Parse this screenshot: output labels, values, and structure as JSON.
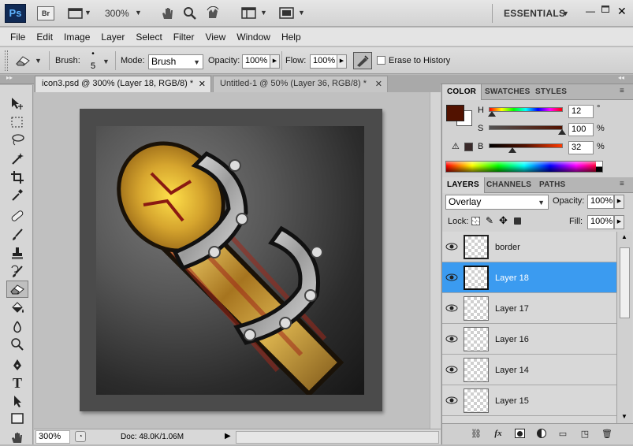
{
  "app": {
    "logo": "Ps",
    "bridge_label": "Br",
    "zoom": "300%",
    "workspace": "ESSENTIALS"
  },
  "menu": [
    "File",
    "Edit",
    "Image",
    "Layer",
    "Select",
    "Filter",
    "View",
    "Window",
    "Help"
  ],
  "options": {
    "brush_label": "Brush:",
    "brush_size": "5",
    "mode_label": "Mode:",
    "mode_value": "Brush",
    "opacity_label": "Opacity:",
    "opacity_value": "100%",
    "flow_label": "Flow:",
    "flow_value": "100%",
    "erase_history_label": "Erase to History"
  },
  "tabs": [
    {
      "label": "icon3.psd @ 300% (Layer 18, RGB/8) *",
      "active": true
    },
    {
      "label": "Untitled-1 @ 50% (Layer 36, RGB/8) *",
      "active": false
    }
  ],
  "status": {
    "zoom": "300%",
    "doc": "Doc: 48.0K/1.06M"
  },
  "color_panel": {
    "tabs": [
      "COLOR",
      "SWATCHES",
      "STYLES"
    ],
    "h_label": "H",
    "h_value": "12",
    "h_unit": "°",
    "s_label": "S",
    "s_value": "100",
    "s_unit": "%",
    "b_label": "B",
    "b_value": "32",
    "b_unit": "%",
    "foreground": "#521200",
    "background": "#ffffff"
  },
  "layers_panel": {
    "tabs": [
      "LAYERS",
      "CHANNELS",
      "PATHS"
    ],
    "blend_mode": "Overlay",
    "opacity_label": "Opacity:",
    "opacity_value": "100%",
    "lock_label": "Lock:",
    "fill_label": "Fill:",
    "fill_value": "100%",
    "layers": [
      {
        "name": "border",
        "selected": false
      },
      {
        "name": "Layer 18",
        "selected": true
      },
      {
        "name": "Layer 17",
        "selected": false
      },
      {
        "name": "Layer 16",
        "selected": false
      },
      {
        "name": "Layer 14",
        "selected": false
      },
      {
        "name": "Layer 15",
        "selected": false
      }
    ]
  },
  "tools": [
    "move-tool",
    "marquee-tool",
    "lasso-tool",
    "magic-wand-tool",
    "crop-tool",
    "eyedropper-tool",
    "healing-brush-tool",
    "brush-tool",
    "clone-stamp-tool",
    "history-brush-tool",
    "eraser-tool",
    "paint-bucket-tool",
    "blur-tool",
    "dodge-tool",
    "pen-tool",
    "type-tool",
    "path-selection-tool",
    "rectangle-tool",
    "hand-tool"
  ],
  "colors": {
    "selection": "#3b9bf0",
    "fg_swatch": "#521200"
  }
}
